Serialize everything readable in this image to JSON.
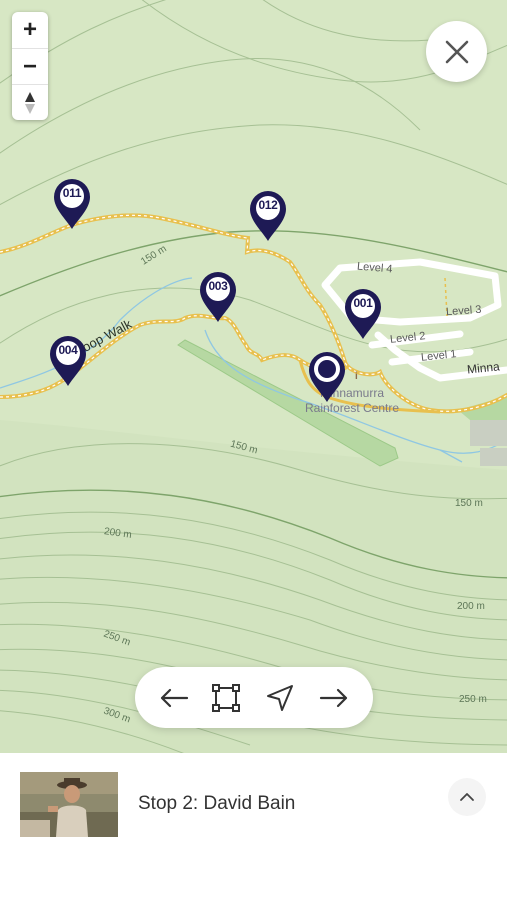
{
  "map": {
    "zoom_in_label": "+",
    "zoom_out_label": "−",
    "close_icon": "close-icon",
    "labels": {
      "walk_name": "oop Walk",
      "place_name_line1": "Minnamurra",
      "place_name_line2": "Rainforest Centre",
      "road_name": "Minna",
      "info_glyph": "i"
    },
    "contours": [
      "150 m",
      "150 m",
      "150 m",
      "200 m",
      "200 m",
      "250 m",
      "250 m",
      "300 m"
    ],
    "levels": [
      "Level 4",
      "Level 3",
      "Level 2",
      "Level 1"
    ],
    "pins": [
      {
        "id": "011",
        "type": "numbered"
      },
      {
        "id": "012",
        "type": "numbered"
      },
      {
        "id": "003",
        "type": "numbered"
      },
      {
        "id": "001",
        "type": "numbered"
      },
      {
        "id": "004",
        "type": "numbered"
      },
      {
        "id": "current",
        "type": "selected"
      }
    ],
    "colors": {
      "pin": "#1e1a55",
      "trail": "#e8c04e",
      "terrain": "#d7e7c4",
      "contour": "#9fb98d",
      "stream": "#8fc7e3"
    }
  },
  "nav": {
    "prev_icon": "arrow-left-icon",
    "fit_icon": "fit-bounds-icon",
    "locate_icon": "locate-icon",
    "next_icon": "arrow-right-icon"
  },
  "panel": {
    "stop_title": "Stop 2: David Bain",
    "expand_icon": "chevron-up-icon"
  }
}
